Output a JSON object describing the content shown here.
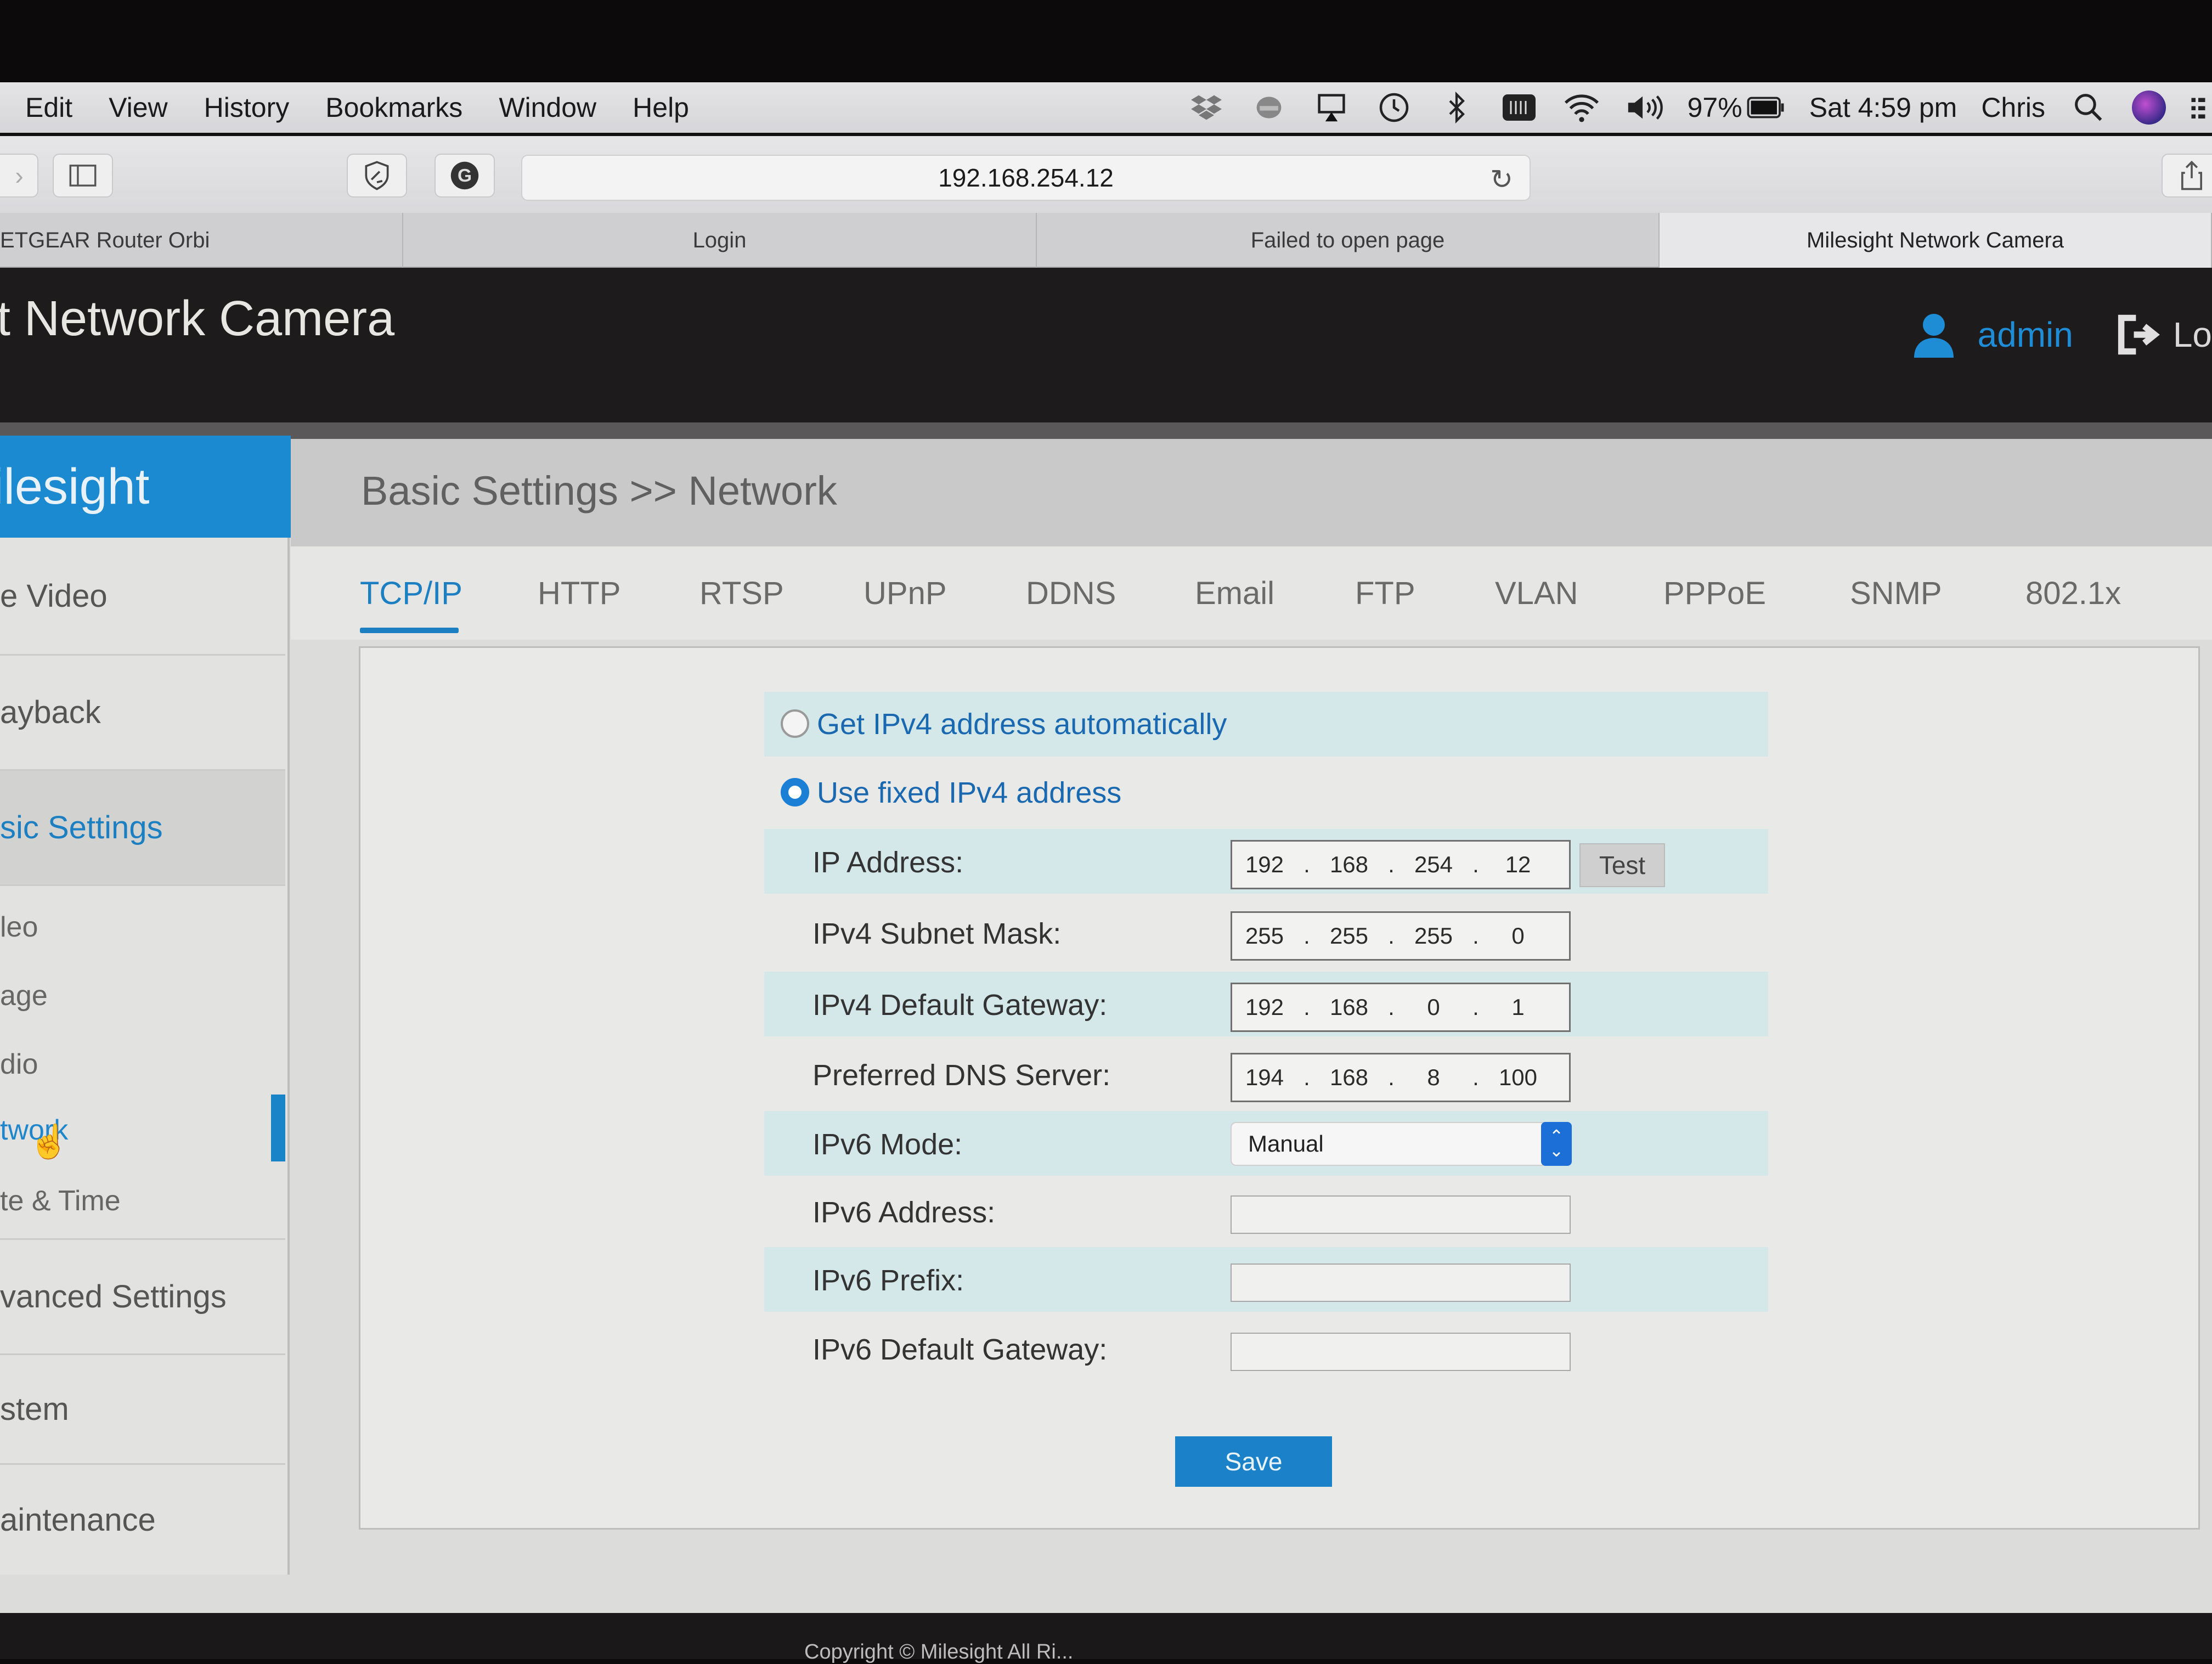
{
  "menubar": {
    "items": [
      "Edit",
      "View",
      "History",
      "Bookmarks",
      "Window",
      "Help"
    ],
    "status": {
      "battery_percent": "97%",
      "datetime": "Sat 4:59 pm",
      "user": "Chris"
    }
  },
  "browser": {
    "url": "192.168.254.12",
    "tabs": [
      {
        "label": "ETGEAR Router Orbi"
      },
      {
        "label": "Login"
      },
      {
        "label": "Failed to open page"
      },
      {
        "label": "Milesight Network Camera",
        "active": true
      }
    ]
  },
  "app": {
    "title": "t Network Camera",
    "user": "admin",
    "logout_label": "Lo",
    "brand": "ilesight",
    "accent_color": "#1b8ad0"
  },
  "sidebar": {
    "items": [
      {
        "label": "e Video",
        "type": "section"
      },
      {
        "label": "ayback",
        "type": "section"
      },
      {
        "label": "sic Settings",
        "type": "section",
        "active": true
      },
      {
        "label": "leo",
        "type": "sub"
      },
      {
        "label": "age",
        "type": "sub"
      },
      {
        "label": "dio",
        "type": "sub"
      },
      {
        "label": "twork",
        "type": "sub",
        "active": true
      },
      {
        "label": "te & Time",
        "type": "sub"
      },
      {
        "label": "vanced Settings",
        "type": "section"
      },
      {
        "label": "stem",
        "type": "section"
      },
      {
        "label": "aintenance",
        "type": "section"
      }
    ]
  },
  "main": {
    "breadcrumb": "Basic Settings >> Network",
    "tabs": [
      "TCP/IP",
      "HTTP",
      "RTSP",
      "UPnP",
      "DDNS",
      "Email",
      "FTP",
      "VLAN",
      "PPPoE",
      "SNMP",
      "802.1x"
    ],
    "active_tab": "TCP/IP",
    "form": {
      "ipv4_mode_options": [
        {
          "label": "Get IPv4 address automatically",
          "checked": false
        },
        {
          "label": "Use fixed IPv4 address",
          "checked": true
        }
      ],
      "ip_address": {
        "label": "IP Address:",
        "octets": [
          "192",
          "168",
          "254",
          "12"
        ]
      },
      "test_label": "Test",
      "subnet_mask": {
        "label": "IPv4 Subnet Mask:",
        "octets": [
          "255",
          "255",
          "255",
          "0"
        ]
      },
      "default_gateway": {
        "label": "IPv4 Default Gateway:",
        "octets": [
          "192",
          "168",
          "0",
          "1"
        ]
      },
      "dns_server": {
        "label": "Preferred DNS Server:",
        "octets": [
          "194",
          "168",
          "8",
          "100"
        ]
      },
      "ipv6_mode": {
        "label": "IPv6 Mode:",
        "value": "Manual"
      },
      "ipv6_address": {
        "label": "IPv6 Address:",
        "value": ""
      },
      "ipv6_prefix": {
        "label": "IPv6 Prefix:",
        "value": ""
      },
      "ipv6_gateway": {
        "label": "IPv6 Default Gateway:",
        "value": ""
      },
      "save_label": "Save"
    }
  },
  "footer": {
    "text": "Copyright © Milesight All Ri..."
  }
}
